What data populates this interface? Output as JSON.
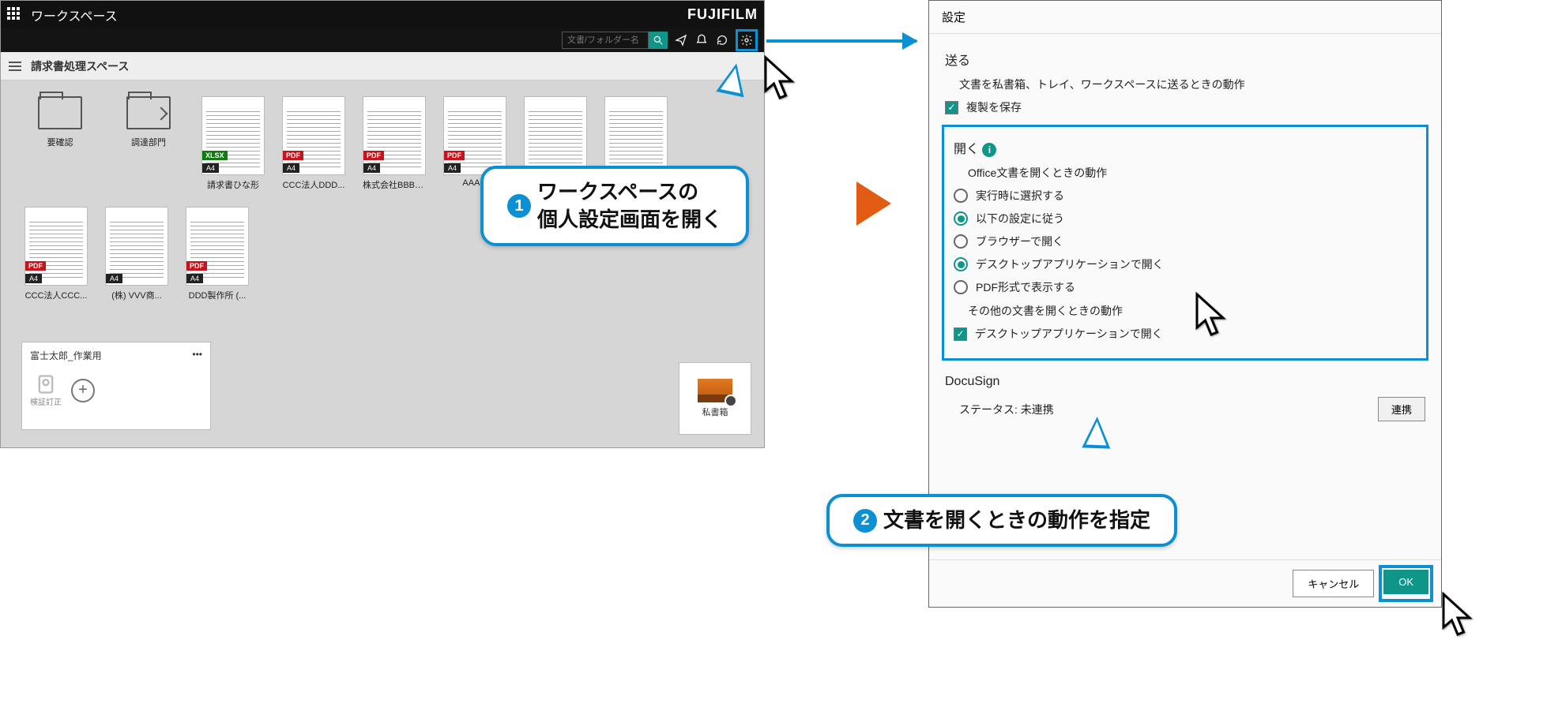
{
  "header": {
    "appTitle": "ワークスペース",
    "brand": "FUJIFILM"
  },
  "toolbar": {
    "searchPlaceholder": "文書/フォルダー名"
  },
  "breadcrumb": {
    "space": "請求書処理スペース"
  },
  "folders": [
    {
      "label": "要確認"
    },
    {
      "label": "調達部門"
    }
  ],
  "docsRow1": [
    {
      "label": "請求書ひな形",
      "tag": "XLSX"
    },
    {
      "label": "CCC法人DDD...",
      "tag": "PDF"
    },
    {
      "label": "株式会社BBB_...",
      "tag": "PDF"
    },
    {
      "label": "AAA...",
      "tag": "PDF"
    },
    {
      "label": "",
      "tag": ""
    },
    {
      "label": "",
      "tag": ""
    }
  ],
  "docsRow2": [
    {
      "label": "CCC法人CCC...",
      "tag": "PDF"
    },
    {
      "label": "(株) VVV商...",
      "tag": ""
    },
    {
      "label": "DDD製作所 (...",
      "tag": "PDF"
    }
  ],
  "paperSize": "A4",
  "personalCard": {
    "title": "富士太郎_作業用",
    "sub": "検証訂正"
  },
  "tray": {
    "label": "私書箱"
  },
  "settings": {
    "title": "設定",
    "send": {
      "heading": "送る",
      "desc": "文書を私書箱、トレイ、ワークスペースに送るときの動作",
      "copyCheckbox": "複製を保存"
    },
    "open": {
      "heading": "開く",
      "officeDesc": "Office文書を開くときの動作",
      "radios": {
        "runtime": "実行時に選択する",
        "follow": "以下の設定に従う",
        "browser": "ブラウザーで開く",
        "desktop": "デスクトップアプリケーションで開く",
        "pdf": "PDF形式で表示する"
      },
      "otherDesc": "その他の文書を開くときの動作",
      "otherCheckbox": "デスクトップアプリケーションで開く"
    },
    "docusign": {
      "heading": "DocuSign",
      "statusLabel": "ステータス:",
      "statusVal": "未連携",
      "linkBtn": "連携"
    },
    "buttons": {
      "cancel": "キャンセル",
      "ok": "OK"
    }
  },
  "callouts": {
    "c1n": "1",
    "c1": "ワークスペースの\n個人設定画面を開く",
    "c2n": "2",
    "c2": "文書を開くときの動作を指定"
  }
}
